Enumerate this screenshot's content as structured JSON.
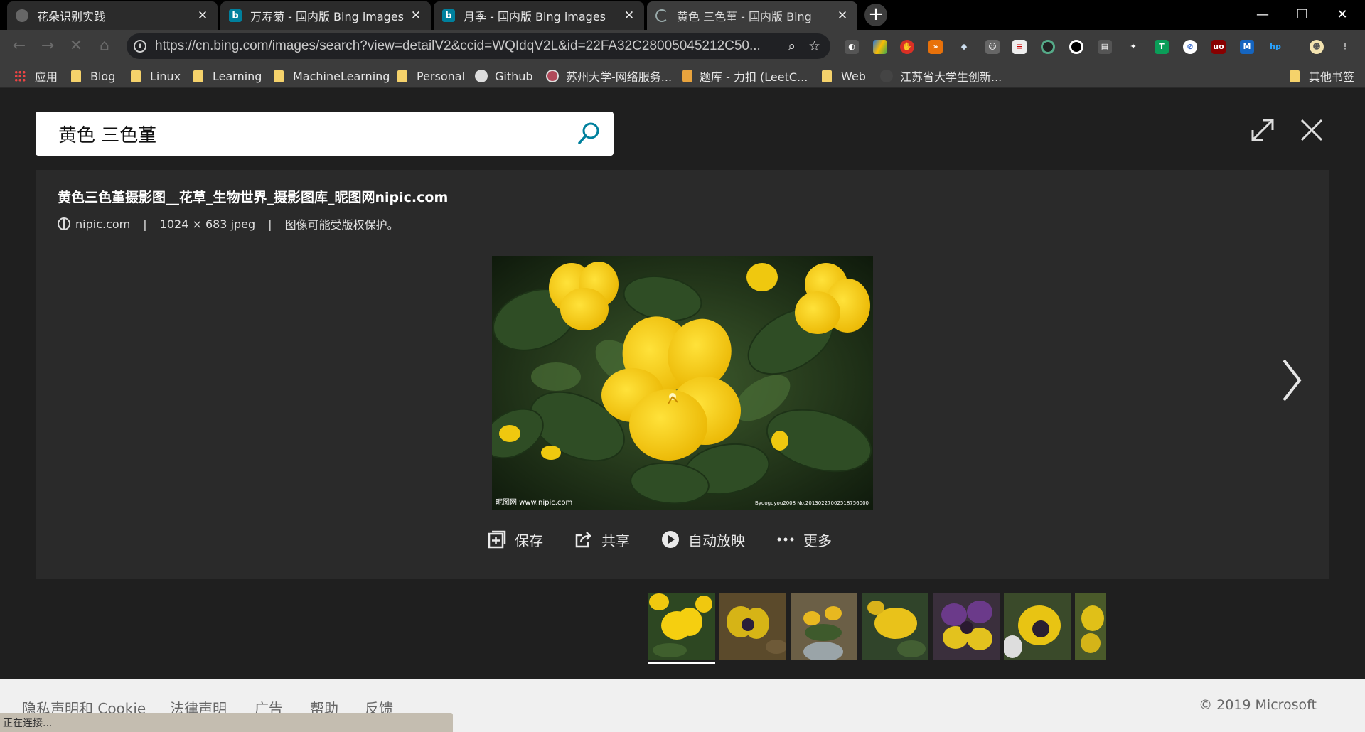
{
  "tabs": [
    {
      "label": "花朵识别实践",
      "icon": "loading-globe-icon"
    },
    {
      "label": "万寿菊 - 国内版 Bing images",
      "icon": "bing-icon"
    },
    {
      "label": "月季 - 国内版 Bing images",
      "icon": "bing-icon"
    },
    {
      "label": "黄色 三色堇 - 国内版 Bing",
      "icon": "loading-spinner-icon"
    }
  ],
  "address_bar": {
    "url": "https://cn.bing.com/images/search?view=detailV2&ccid=WQIdqV2L&id=22FA32C28005045212C50..."
  },
  "bookmarks": [
    {
      "label": "应用",
      "icon": "apps-grid-icon"
    },
    {
      "label": "Blog",
      "icon": "folder-icon"
    },
    {
      "label": "Linux",
      "icon": "folder-icon"
    },
    {
      "label": "Learning",
      "icon": "folder-icon"
    },
    {
      "label": "MachineLearning",
      "icon": "folder-icon"
    },
    {
      "label": "Personal",
      "icon": "folder-icon"
    },
    {
      "label": "Github",
      "icon": "github-icon"
    },
    {
      "label": "苏州大学-网络服务...",
      "icon": "university-icon"
    },
    {
      "label": "题库 - 力扣 (LeetC...",
      "icon": "leetcode-icon"
    },
    {
      "label": "Web",
      "icon": "folder-icon"
    },
    {
      "label": "江苏省大学生创新...",
      "icon": "site-icon"
    },
    {
      "label": "其他书签",
      "icon": "folder-icon"
    }
  ],
  "search": {
    "query": "黄色 三色堇"
  },
  "detail": {
    "title": "黄色三色堇摄影图__花草_生物世界_摄影图库_昵图网nipic.com",
    "source": "nipic.com",
    "size": "1024 × 683 jpeg",
    "copyright_note": "图像可能受版权保护。",
    "separator": "|",
    "watermark_left": "昵图网 www.nipic.com",
    "watermark_right": "Bydogoyou2008 No.20130227002518756000",
    "actions": {
      "save": "保存",
      "share": "共享",
      "slideshow": "自动放映",
      "more": "更多"
    }
  },
  "footer": {
    "links": [
      "隐私声明和 Cookie",
      "法律声明",
      "广告",
      "帮助",
      "反馈"
    ],
    "copyright": "© 2019 Microsoft"
  },
  "status_bar": "正在连接...",
  "colors": {
    "page_bg": "#1f1f1f",
    "panel_bg": "#2a2a2a",
    "accent": "#00809d",
    "flower_yellow": "#f7cf12"
  }
}
